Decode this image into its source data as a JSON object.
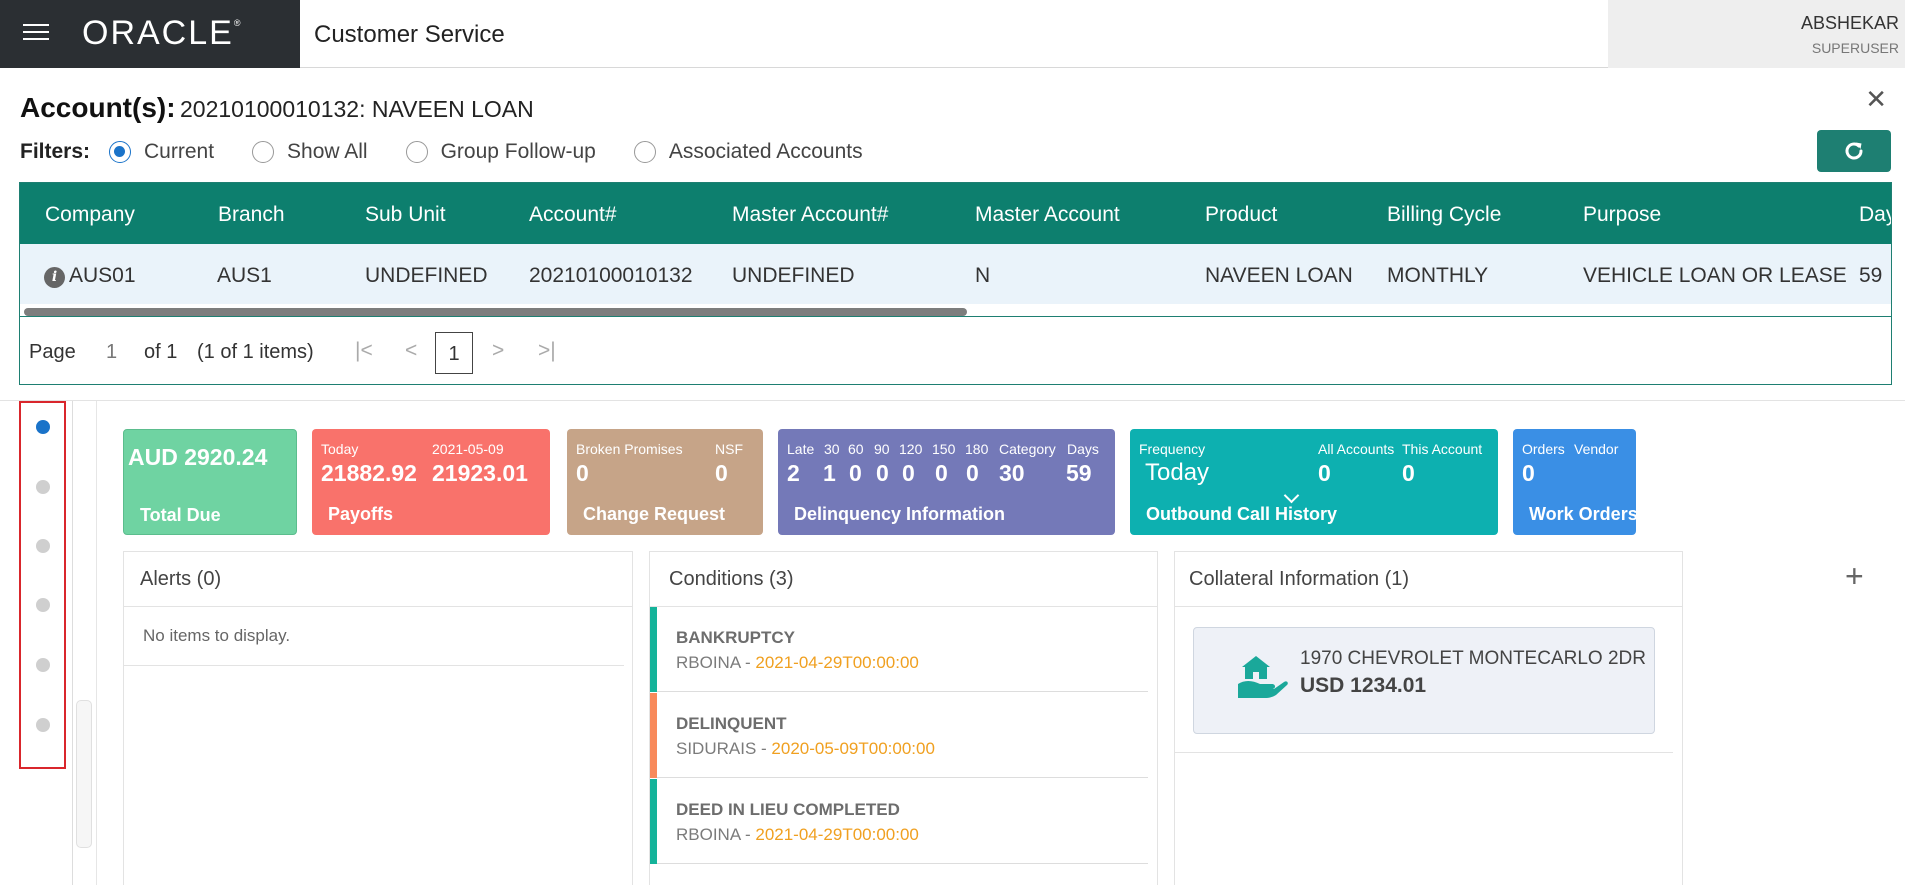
{
  "header": {
    "brand": "ORACLE",
    "app_title": "Customer Service",
    "user_name": "ABSHEKAR",
    "user_role": "SUPERUSER"
  },
  "account": {
    "label": "Account(s):",
    "value": "20210100010132: NAVEEN LOAN"
  },
  "filters": {
    "label": "Filters:",
    "options": [
      "Current",
      "Show All",
      "Group Follow-up",
      "Associated Accounts"
    ],
    "selected": "Current"
  },
  "grid": {
    "columns": [
      "Company",
      "Branch",
      "Sub Unit",
      "Account#",
      "Master Account#",
      "Master Account",
      "Product",
      "Billing Cycle",
      "Purpose",
      "Day"
    ],
    "rows": [
      [
        "AUS01",
        "AUS1",
        "UNDEFINED",
        "20210100010132",
        "UNDEFINED",
        "N",
        "NAVEEN LOAN",
        "MONTHLY",
        "VEHICLE LOAN OR LEASE",
        "59"
      ]
    ]
  },
  "pager": {
    "page_label": "Page",
    "page_value": "1",
    "of_label": "of 1",
    "items_label": "(1 of 1 items)",
    "current": "1"
  },
  "tiles": {
    "total_due": {
      "amount": "AUD 2920.24",
      "label": "Total Due"
    },
    "payoffs": {
      "col1_head": "Today",
      "col1_value": "21882.92",
      "col2_head": "2021-05-09",
      "col2_value": "21923.01",
      "label": "Payoffs"
    },
    "change_request": {
      "col1_head": "Broken Promises",
      "col1_value": "0",
      "col2_head": "NSF",
      "col2_value": "0",
      "label": "Change Request"
    },
    "delinquency": {
      "heads": [
        "Late",
        "30",
        "60",
        "90",
        "120",
        "150",
        "180",
        "Category",
        "Days"
      ],
      "values": [
        "2",
        "1",
        "0",
        "0",
        "0",
        "0",
        "0",
        "30",
        "59"
      ],
      "label": "Delinquency Information"
    },
    "outbound": {
      "frequency_head": "Frequency",
      "frequency_value": "Today",
      "all_head": "All Accounts",
      "all_value": "0",
      "this_head": "This Account",
      "this_value": "0",
      "label": "Outbound Call History"
    },
    "work_orders": {
      "orders_head": "Orders",
      "vendor_head": "Vendor",
      "orders_value": "0",
      "label": "Work Orders"
    }
  },
  "panels": {
    "alerts": {
      "title": "Alerts (0)",
      "empty": "No items to display."
    },
    "conditions": {
      "title": "Conditions (3)",
      "items": [
        {
          "name": "BANKRUPTCY",
          "user": "RBOINA",
          "date": "2021-04-29T00:00:00",
          "color": "#14b39a"
        },
        {
          "name": "DELINQUENT",
          "user": "SIDURAIS",
          "date": "2020-05-09T00:00:00",
          "color": "#f88a5b"
        },
        {
          "name": "DEED IN LIEU COMPLETED",
          "user": "RBOINA",
          "date": "2021-04-29T00:00:00",
          "color": "#14b39a"
        }
      ]
    },
    "collateral": {
      "title": "Collateral Information (1)",
      "name": "1970 CHEVROLET MONTECARLO 2DR",
      "amount": "USD 1234.01"
    }
  },
  "colors": {
    "header_dark": "#2b2f33",
    "teal_primary": "#0d7f6e",
    "highlight_red": "#d9262c"
  }
}
